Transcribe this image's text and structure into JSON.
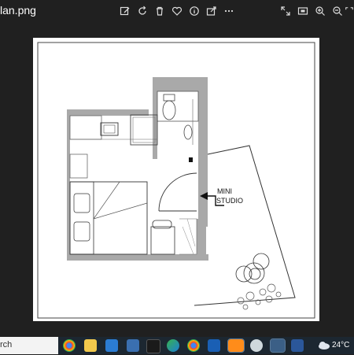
{
  "window": {
    "title": "lan.png",
    "toolbar": [
      {
        "name": "edit-image-icon"
      },
      {
        "name": "rotate-icon"
      },
      {
        "name": "delete-icon"
      },
      {
        "name": "favorite-icon"
      },
      {
        "name": "info-icon"
      },
      {
        "name": "share-icon"
      },
      {
        "name": "more-icon"
      }
    ],
    "controls": [
      {
        "name": "expand-icon"
      },
      {
        "name": "slideshow-icon"
      },
      {
        "name": "zoom-in-icon"
      },
      {
        "name": "zoom-out-icon"
      },
      {
        "name": "fullscreen-icon"
      }
    ]
  },
  "floorplan": {
    "label_line1": "MINI",
    "label_line2": "STUDIO"
  },
  "taskbar": {
    "search_placeholder": "rch",
    "apps": [
      "chrome-icon",
      "file-explorer-icon",
      "calendar-icon",
      "video-app-icon",
      "media-player-icon",
      "edge-icon",
      "chrome-icon",
      "image-editor-icon",
      "internet-explorer-icon",
      "app-icon",
      "photos-icon",
      "word-icon"
    ],
    "weather_temp": "24°C"
  },
  "colors": {
    "background": "#202020",
    "wall": "#a9a9a9",
    "taskbar": "#1c2731"
  }
}
